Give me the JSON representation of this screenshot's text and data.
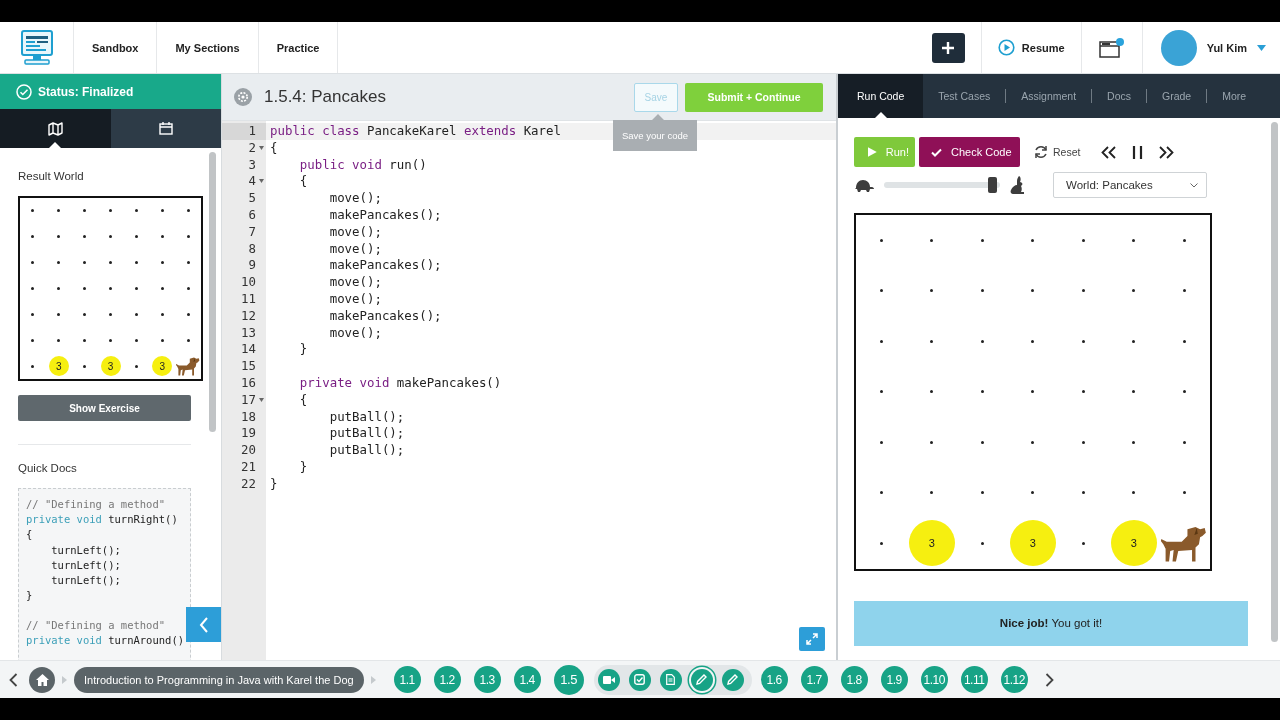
{
  "nav": {
    "items": [
      {
        "label": "Sandbox"
      },
      {
        "label": "My Sections"
      },
      {
        "label": "Practice"
      }
    ],
    "resume": "Resume",
    "notification": true,
    "user": "Yul Kim"
  },
  "status": {
    "label": "Status: Finalized"
  },
  "left_tabs": [
    {
      "kind": "map",
      "selected": true
    },
    {
      "kind": "calendar",
      "selected": false
    }
  ],
  "result_world": {
    "title": "Result World",
    "bottom_row": [
      {
        "kind": "dot"
      },
      {
        "kind": "ball",
        "count": "3"
      },
      {
        "kind": "dot"
      },
      {
        "kind": "ball",
        "count": "3"
      },
      {
        "kind": "dot"
      },
      {
        "kind": "ball",
        "count": "3"
      },
      {
        "kind": "dog"
      }
    ]
  },
  "show_exercise": "Show Exercise",
  "quick_docs": {
    "title": "Quick Docs",
    "lines": [
      {
        "kind": "code",
        "parts": [
          {
            "kind": "comment",
            "text": "// \"Defining a method\""
          }
        ]
      },
      {
        "kind": "code",
        "parts": [
          {
            "kind": "keyword",
            "text": "private void"
          },
          {
            "kind": "plain",
            "text": " turnRight()"
          }
        ]
      },
      {
        "kind": "code",
        "parts": [
          {
            "kind": "plain",
            "text": "{"
          }
        ]
      },
      {
        "kind": "code",
        "parts": [
          {
            "kind": "plain",
            "text": "    turnLeft();"
          }
        ]
      },
      {
        "kind": "code",
        "parts": [
          {
            "kind": "plain",
            "text": "    turnLeft();"
          }
        ]
      },
      {
        "kind": "code",
        "parts": [
          {
            "kind": "plain",
            "text": "    turnLeft();"
          }
        ]
      },
      {
        "kind": "code",
        "parts": [
          {
            "kind": "plain",
            "text": "}"
          }
        ]
      },
      {
        "kind": "blank"
      },
      {
        "kind": "code",
        "parts": [
          {
            "kind": "comment",
            "text": "// \"Defining a method\""
          }
        ]
      },
      {
        "kind": "code",
        "parts": [
          {
            "kind": "keyword",
            "text": "private void"
          },
          {
            "kind": "plain",
            "text": " turnAround()"
          }
        ]
      }
    ]
  },
  "editor": {
    "title": "1.5.4: Pancakes",
    "save": "Save",
    "tooltip": "Save your code",
    "submit": "Submit + Continue",
    "lines": [
      {
        "number": "1",
        "active": true,
        "fold": false,
        "code": [
          {
            "kind": "keyword",
            "text": "public class"
          },
          {
            "kind": "plain",
            "text": " PancakeKarel "
          },
          {
            "kind": "keyword",
            "text": "extends"
          },
          {
            "kind": "plain",
            "text": " Karel"
          }
        ]
      },
      {
        "number": "2",
        "active": false,
        "fold": true,
        "code": [
          {
            "kind": "plain",
            "text": "{"
          }
        ]
      },
      {
        "number": "3",
        "active": false,
        "fold": false,
        "code": [
          {
            "kind": "keyword",
            "text": "    public void"
          },
          {
            "kind": "plain",
            "text": " run()"
          }
        ]
      },
      {
        "number": "4",
        "active": false,
        "fold": true,
        "code": [
          {
            "kind": "plain",
            "text": "    {"
          }
        ]
      },
      {
        "number": "5",
        "active": false,
        "fold": false,
        "code": [
          {
            "kind": "plain",
            "text": "        move();"
          }
        ]
      },
      {
        "number": "6",
        "active": false,
        "fold": false,
        "code": [
          {
            "kind": "plain",
            "text": "        makePancakes();"
          }
        ]
      },
      {
        "number": "7",
        "active": false,
        "fold": false,
        "code": [
          {
            "kind": "plain",
            "text": "        move();"
          }
        ]
      },
      {
        "number": "8",
        "active": false,
        "fold": false,
        "code": [
          {
            "kind": "plain",
            "text": "        move();"
          }
        ]
      },
      {
        "number": "9",
        "active": false,
        "fold": false,
        "code": [
          {
            "kind": "plain",
            "text": "        makePancakes();"
          }
        ]
      },
      {
        "number": "10",
        "active": false,
        "fold": false,
        "code": [
          {
            "kind": "plain",
            "text": "        move();"
          }
        ]
      },
      {
        "number": "11",
        "active": false,
        "fold": false,
        "code": [
          {
            "kind": "plain",
            "text": "        move();"
          }
        ]
      },
      {
        "number": "12",
        "active": false,
        "fold": false,
        "code": [
          {
            "kind": "plain",
            "text": "        makePancakes();"
          }
        ]
      },
      {
        "number": "13",
        "active": false,
        "fold": false,
        "code": [
          {
            "kind": "plain",
            "text": "        move();"
          }
        ]
      },
      {
        "number": "14",
        "active": false,
        "fold": false,
        "code": [
          {
            "kind": "plain",
            "text": "    }"
          }
        ]
      },
      {
        "number": "15",
        "active": false,
        "fold": false
      },
      {
        "number": "16",
        "active": false,
        "fold": false,
        "code": [
          {
            "kind": "keyword",
            "text": "    private void"
          },
          {
            "kind": "plain",
            "text": " makePancakes()"
          }
        ]
      },
      {
        "number": "17",
        "active": false,
        "fold": true,
        "code": [
          {
            "kind": "plain",
            "text": "    {"
          }
        ]
      },
      {
        "number": "18",
        "active": false,
        "fold": false,
        "code": [
          {
            "kind": "plain",
            "text": "        putBall();"
          }
        ]
      },
      {
        "number": "19",
        "active": false,
        "fold": false,
        "code": [
          {
            "kind": "plain",
            "text": "        putBall();"
          }
        ]
      },
      {
        "number": "20",
        "active": false,
        "fold": false,
        "code": [
          {
            "kind": "plain",
            "text": "        putBall();"
          }
        ]
      },
      {
        "number": "21",
        "active": false,
        "fold": false,
        "code": [
          {
            "kind": "plain",
            "text": "    }"
          }
        ]
      },
      {
        "number": "22",
        "active": false,
        "fold": false,
        "code": [
          {
            "kind": "plain",
            "text": "}"
          }
        ]
      }
    ]
  },
  "run_tabs": [
    {
      "label": "Run Code",
      "selected": true
    },
    {
      "label": "Test Cases",
      "selected": false
    },
    {
      "label": "Assignment",
      "selected": false
    },
    {
      "label": "Docs",
      "selected": false
    },
    {
      "label": "Grade",
      "selected": false
    },
    {
      "label": "More",
      "selected": false
    }
  ],
  "controls": {
    "run": "Run!",
    "check": "Check Code",
    "reset": "Reset",
    "speed": {
      "level": 0.97
    },
    "world_select": "World: Pancakes"
  },
  "world": {
    "bottom_row": [
      {
        "kind": "dot"
      },
      {
        "kind": "ball",
        "count": "3"
      },
      {
        "kind": "dot"
      },
      {
        "kind": "ball",
        "count": "3"
      },
      {
        "kind": "dot"
      },
      {
        "kind": "ball",
        "count": "3"
      },
      {
        "kind": "dog"
      }
    ]
  },
  "message": "**Nice job!** You got it!",
  "breadcrumb": {
    "label": "Introduction to Programming in Java with Karel the Dog"
  },
  "progress": [
    {
      "kind": "section",
      "label": "1.1",
      "selected": false
    },
    {
      "kind": "section",
      "label": "1.2",
      "selected": false
    },
    {
      "kind": "section",
      "label": "1.3",
      "selected": false
    },
    {
      "kind": "section",
      "label": "1.4",
      "selected": false
    },
    {
      "kind": "section",
      "label": "1.5",
      "selected": true
    },
    {
      "kind": "video",
      "selected": false
    },
    {
      "kind": "check",
      "selected": false
    },
    {
      "kind": "doc",
      "selected": false
    },
    {
      "kind": "pencil",
      "selected": true
    },
    {
      "kind": "pencil",
      "selected": false
    },
    {
      "kind": "section",
      "label": "1.6",
      "selected": false
    },
    {
      "kind": "section",
      "label": "1.7",
      "selected": false
    },
    {
      "kind": "section",
      "label": "1.8",
      "selected": false
    },
    {
      "kind": "section",
      "label": "1.9",
      "selected": false
    },
    {
      "kind": "section",
      "label": "1.10",
      "selected": false
    },
    {
      "kind": "section",
      "label": "1.11",
      "selected": false
    },
    {
      "kind": "section",
      "label": "1.12",
      "selected": false
    }
  ]
}
